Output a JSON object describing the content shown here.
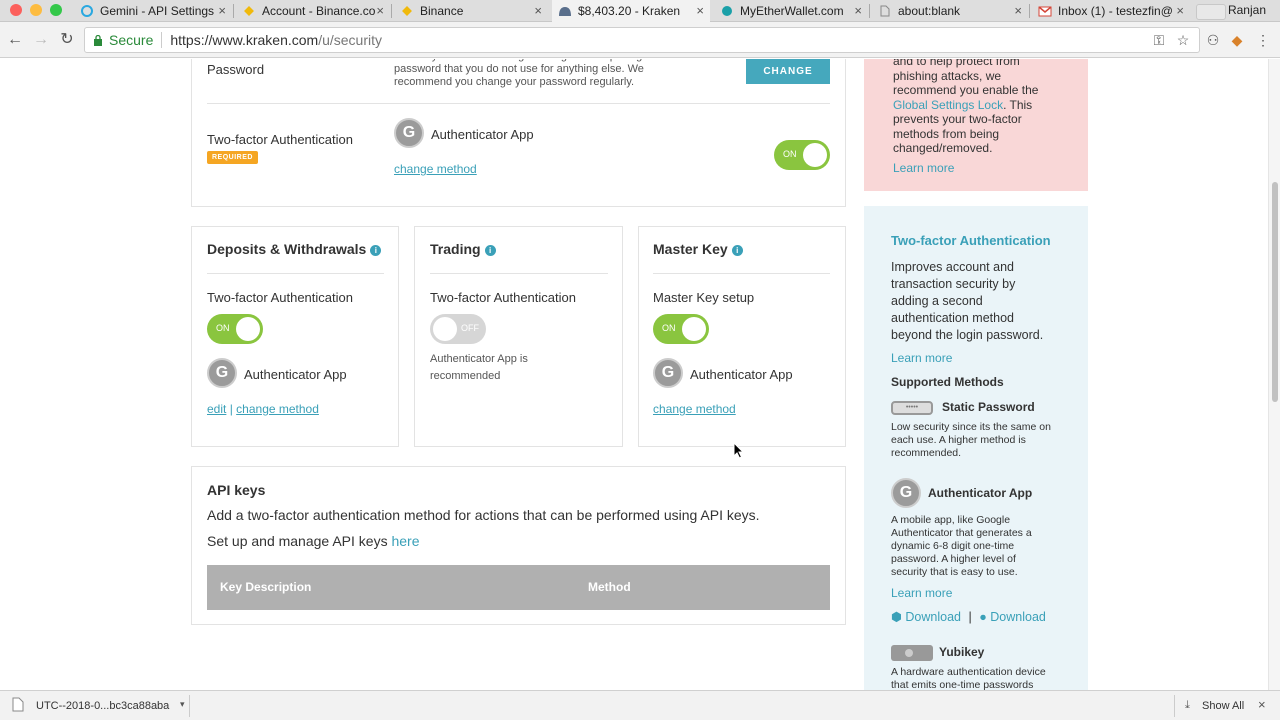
{
  "browser": {
    "tabs": [
      {
        "title": "Gemini - API Settings",
        "icon": "gemini-icon",
        "color": "#2aa8e0"
      },
      {
        "title": "Account - Binance.co",
        "icon": "binance-icon",
        "color": "#f0b90b"
      },
      {
        "title": "Binance",
        "icon": "binance-icon",
        "color": "#f0b90b"
      },
      {
        "title": "$8,403.20 - Kraken",
        "icon": "kraken-icon",
        "color": "#5a6f8c",
        "active": true
      },
      {
        "title": "MyEtherWallet.com",
        "icon": "mew-icon",
        "color": "#1aa0a8"
      },
      {
        "title": "about:blank",
        "icon": "page-icon",
        "color": "#888888"
      },
      {
        "title": "Inbox (1) - testezfin@",
        "icon": "gmail-icon",
        "color": "#d44638"
      }
    ],
    "profile_name": "Ranjan",
    "secure_label": "Secure",
    "url_base": "https://www.kraken.com",
    "url_path": "/u/security"
  },
  "security": {
    "password": {
      "label": "Password",
      "desc": "Protect your account using a strong and unique login password that you do not use for anything else. We recommend you change your password regularly.",
      "button": "CHANGE"
    },
    "login_2fa": {
      "label": "Two-factor Authentication",
      "badge": "REQUIRED",
      "method": "Authenticator App",
      "change_link": "change method",
      "toggle": "ON"
    },
    "deposits": {
      "title": "Deposits & Withdrawals",
      "label": "Two-factor Authentication",
      "toggle": "ON",
      "method": "Authenticator App",
      "edit_link": "edit",
      "sep": "|",
      "change_link": "change method"
    },
    "trading": {
      "title": "Trading",
      "label": "Two-factor Authentication",
      "toggle": "OFF",
      "note_line1": "Authenticator App is",
      "note_line2": "recommended"
    },
    "master_key": {
      "title": "Master Key",
      "label": "Master Key setup",
      "toggle": "ON",
      "method": "Authenticator App",
      "change_link": "change method"
    },
    "api_keys": {
      "title": "API keys",
      "desc": "Add a two-factor authentication method for actions that can be performed using API keys.",
      "manage_text": "Set up and manage API keys",
      "manage_link": "here",
      "col_description": "Key Description",
      "col_method": "Method"
    }
  },
  "sidebar": {
    "warning": {
      "lines": [
        "and to help protect from",
        "phishing attacks, we",
        "recommend you enable the"
      ],
      "link": "Global Settings Lock",
      "after_link": ". This",
      "lines2": [
        "prevents your two-factor",
        "methods from being",
        "changed/removed."
      ],
      "learn_more": "Learn more"
    },
    "tfa": {
      "title": "Two-factor Authentication",
      "desc_lines": [
        "Improves account and",
        "transaction security by",
        "adding a second",
        "authentication method",
        "beyond the login password."
      ],
      "learn_more": "Learn more",
      "supported": "Supported Methods",
      "static_password": {
        "name": "Static Password",
        "desc_lines": [
          "Low security since its the same on",
          "each use. A higher method is",
          "recommended."
        ]
      },
      "authenticator": {
        "name": "Authenticator App",
        "desc_lines": [
          "A mobile app, like Google",
          "Authenticator that generates a",
          "dynamic 6-8 digit one-time",
          "password. A higher level of",
          "security that is easy to use."
        ],
        "learn_more": "Learn more",
        "download_android": "Download",
        "download_ios": "Download",
        "sep": "|"
      },
      "yubikey": {
        "name": "Yubikey",
        "desc_lines": [
          "A hardware authentication device",
          "that emits one-time passwords"
        ]
      }
    }
  },
  "download_bar": {
    "file_name": "UTC--2018-0...bc3ca88aba",
    "show_all": "Show All"
  }
}
